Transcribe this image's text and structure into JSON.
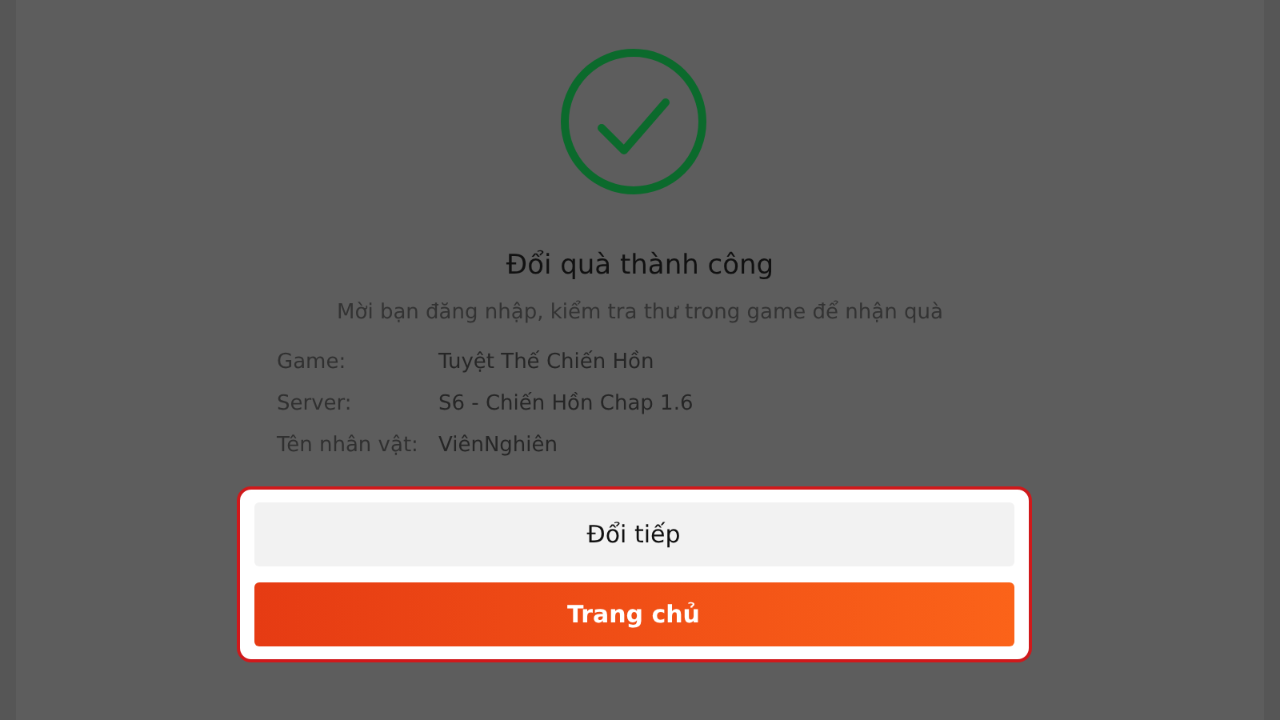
{
  "dialog": {
    "title": "Đổi quà thành công",
    "message": "Mời bạn đăng nhập, kiểm tra thư trong game để nhận quà",
    "details": [
      {
        "label": "Game:",
        "value": "Tuyệt Thế Chiến Hồn"
      },
      {
        "label": "Server:",
        "value": "S6 - Chiến Hồn Chap 1.6"
      },
      {
        "label": "Tên nhân vật:",
        "value": "ViênNghiên"
      }
    ],
    "actions": {
      "highlighted": true,
      "buttons": [
        {
          "label": "Đổi tiếp",
          "kind": "secondary"
        },
        {
          "label": "Trang chủ",
          "kind": "primary"
        }
      ]
    }
  }
}
